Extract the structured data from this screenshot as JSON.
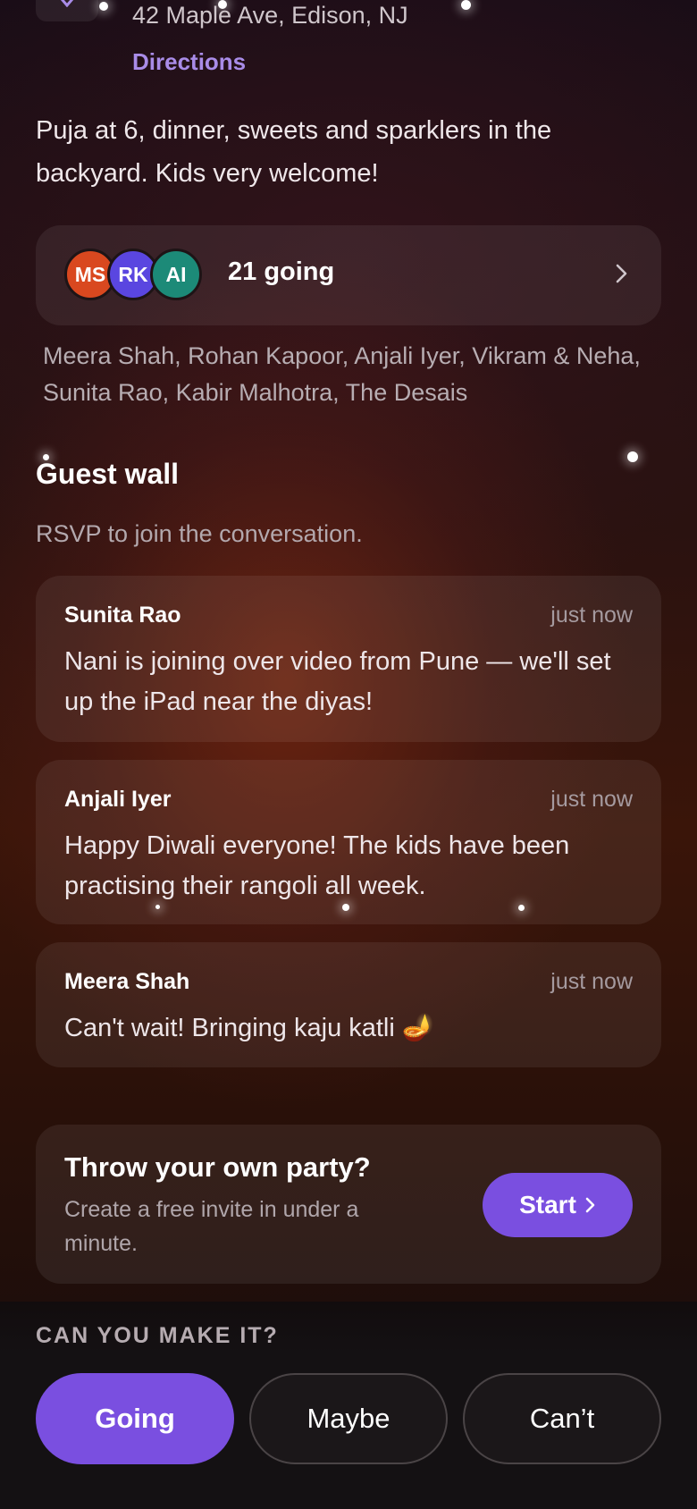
{
  "location": {
    "address": "42 Maple Ave, Edison, NJ",
    "directions_label": "Directions",
    "icon": "location-icon"
  },
  "description": "Puja at 6, dinner, sweets and sparklers in the backyard. Kids very welcome!",
  "attendees": {
    "avatars": [
      {
        "initials": "MS",
        "color": "#d9481f"
      },
      {
        "initials": "RK",
        "color": "#5a46e0"
      },
      {
        "initials": "AI",
        "color": "#1c8a78"
      }
    ],
    "count_label": "21 going",
    "names": "Meera Shah, Rohan Kapoor, Anjali Iyer, Vikram & Neha, Sunita Rao, Kabir Malhotra, The Desais"
  },
  "guest_wall": {
    "title": "Guest wall",
    "subtitle": "RSVP to join the conversation.",
    "comments": [
      {
        "name": "Sunita Rao",
        "time": "just now",
        "text": "Nani is joining over video from Pune — we'll set up the iPad near the diyas!"
      },
      {
        "name": "Anjali Iyer",
        "time": "just now",
        "text": "Happy Diwali everyone! The kids have been practising their rangoli all week."
      },
      {
        "name": "Meera Shah",
        "time": "just now",
        "text": "Can't wait! Bringing kaju katli 🪔"
      }
    ]
  },
  "promo": {
    "title": "Throw your own party?",
    "subtitle": "Create a free invite in under a minute.",
    "button_label": "Start"
  },
  "rsvp": {
    "prompt": "CAN YOU MAKE IT?",
    "going": "Going",
    "maybe": "Maybe",
    "cant": "Can’t",
    "selected": "Going"
  },
  "colors": {
    "accent": "#7a4fe0",
    "link": "#a98ce8"
  }
}
